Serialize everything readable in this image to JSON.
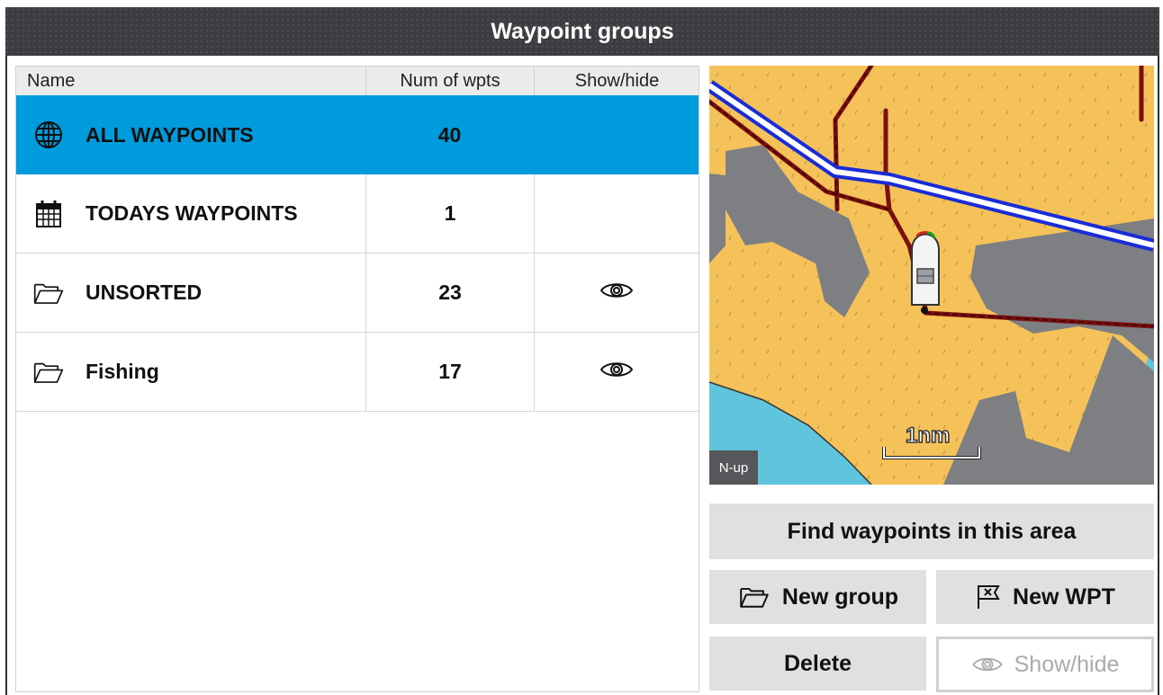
{
  "window": {
    "title": "Waypoint groups"
  },
  "table": {
    "headers": {
      "name": "Name",
      "count": "Num of wpts",
      "show": "Show/hide"
    },
    "rows": [
      {
        "label": "ALL WAYPOINTS",
        "count": "40",
        "icon": "globe-icon",
        "visible": null,
        "selected": true
      },
      {
        "label": "TODAYS WAYPOINTS",
        "count": "1",
        "icon": "calendar-icon",
        "visible": null,
        "selected": false
      },
      {
        "label": "UNSORTED",
        "count": "23",
        "icon": "folder-icon",
        "visible": true,
        "selected": false
      },
      {
        "label": "Fishing",
        "count": "17",
        "icon": "folder-icon",
        "visible": true,
        "selected": false
      }
    ]
  },
  "map": {
    "orientation": "N-up",
    "scale": "1nm"
  },
  "actions": {
    "find": "Find waypoints in this area",
    "new_group": "New group",
    "new_wpt": "New WPT",
    "delete": "Delete",
    "show_hide": "Show/hide"
  },
  "colors": {
    "title_bar": "#3b3d40",
    "selected_row": "#009bdc",
    "button": "#dfe1e1",
    "land": "#f5c25a",
    "restricted_area": "#7d7f82",
    "water": "#5fc5dc"
  }
}
